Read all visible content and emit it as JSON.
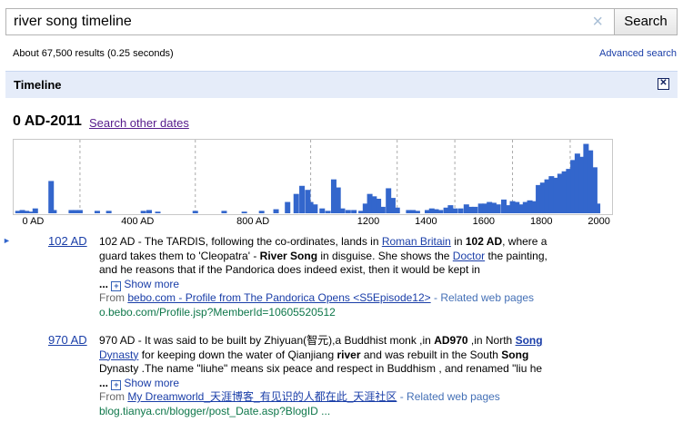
{
  "search": {
    "query": "river song timeline",
    "button": "Search"
  },
  "stats": {
    "text": "About 67,500 results (0.25 seconds)",
    "advanced": "Advanced search"
  },
  "timeline": {
    "title": "Timeline",
    "range": "0 AD-2011",
    "other_dates": "Search other dates"
  },
  "chart_data": {
    "type": "bar",
    "xlabel": "",
    "ylabel": "",
    "xlim": [
      -30,
      2020
    ],
    "tick_labels": [
      "0 AD",
      "400 AD",
      "800 AD",
      "1200",
      "1400",
      "1600",
      "1800",
      "2000"
    ],
    "tick_values": [
      0,
      400,
      800,
      1200,
      1400,
      1600,
      1800,
      2000
    ],
    "bars": [
      [
        -15,
        3
      ],
      [
        0,
        4
      ],
      [
        15,
        3
      ],
      [
        30,
        2
      ],
      [
        45,
        6
      ],
      [
        100,
        40
      ],
      [
        110,
        4
      ],
      [
        170,
        4
      ],
      [
        185,
        4
      ],
      [
        200,
        4
      ],
      [
        260,
        3
      ],
      [
        300,
        3
      ],
      [
        420,
        3
      ],
      [
        440,
        4
      ],
      [
        470,
        2
      ],
      [
        600,
        3
      ],
      [
        700,
        3
      ],
      [
        770,
        2
      ],
      [
        830,
        3
      ],
      [
        880,
        5
      ],
      [
        920,
        14
      ],
      [
        950,
        24
      ],
      [
        970,
        34
      ],
      [
        990,
        29
      ],
      [
        1000,
        14
      ],
      [
        1015,
        11
      ],
      [
        1040,
        6
      ],
      [
        1060,
        3
      ],
      [
        1080,
        42
      ],
      [
        1095,
        32
      ],
      [
        1110,
        6
      ],
      [
        1130,
        4
      ],
      [
        1150,
        4
      ],
      [
        1175,
        3
      ],
      [
        1190,
        12
      ],
      [
        1205,
        24
      ],
      [
        1220,
        21
      ],
      [
        1235,
        18
      ],
      [
        1250,
        8
      ],
      [
        1270,
        31
      ],
      [
        1285,
        19
      ],
      [
        1300,
        7
      ],
      [
        1340,
        4
      ],
      [
        1355,
        4
      ],
      [
        1370,
        3
      ],
      [
        1405,
        4
      ],
      [
        1420,
        6
      ],
      [
        1435,
        5
      ],
      [
        1450,
        4
      ],
      [
        1470,
        7
      ],
      [
        1485,
        10
      ],
      [
        1500,
        6
      ],
      [
        1520,
        6
      ],
      [
        1540,
        11
      ],
      [
        1555,
        8
      ],
      [
        1570,
        8
      ],
      [
        1590,
        12
      ],
      [
        1605,
        12
      ],
      [
        1620,
        14
      ],
      [
        1635,
        13
      ],
      [
        1650,
        11
      ],
      [
        1670,
        17
      ],
      [
        1685,
        10
      ],
      [
        1700,
        15
      ],
      [
        1715,
        14
      ],
      [
        1730,
        11
      ],
      [
        1745,
        14
      ],
      [
        1760,
        16
      ],
      [
        1775,
        15
      ],
      [
        1790,
        35
      ],
      [
        1805,
        38
      ],
      [
        1820,
        42
      ],
      [
        1835,
        46
      ],
      [
        1850,
        44
      ],
      [
        1865,
        49
      ],
      [
        1880,
        52
      ],
      [
        1895,
        55
      ],
      [
        1910,
        66
      ],
      [
        1925,
        74
      ],
      [
        1940,
        70
      ],
      [
        1955,
        86
      ],
      [
        1970,
        78
      ],
      [
        1985,
        57
      ],
      [
        1995,
        12
      ]
    ],
    "ylim": [
      0,
      90
    ],
    "grid": true
  },
  "results": [
    {
      "date": "102 AD",
      "line1_pre": "102 AD - The TARDIS, following the co-ordinates, lands in ",
      "line1_link": "Roman Britain",
      "line1_mid": " in ",
      "line1_bold": "102 AD",
      "line1_post": ", where a",
      "line2_pre": "guard takes them to 'Cleopatra' - ",
      "line2_bold": "River Song",
      "line2_mid": " in disguise. She shows the ",
      "line2_link": "Doctor",
      "line2_post": " the painting,",
      "line3": "and he reasons that if the Pandorica does indeed exist, then it would be kept in",
      "ellipsis": "...",
      "show_more": "Show more",
      "from": "From ",
      "source": "bebo.com - Profile from The Pandorica Opens <S5Episode12>",
      "related": " - Related web pages",
      "url": "o.bebo.com/Profile.jsp?MemberId=10605520512"
    },
    {
      "date": "970 AD",
      "line1_pre": "970 AD - It was said to be built by Zhiyuan(智元),a Buddhist monk ,in ",
      "line1_bold": "AD970",
      "line1_mid": " ,in North ",
      "line1_link": "Song",
      "line2_link": "Dynasty",
      "line2_pre": " for keeping down the water of Qianjiang ",
      "line2_bold": "river",
      "line2_mid": " and was rebuilt in the South ",
      "line2_bold2": "Song",
      "line3": "Dynasty .The name \"liuhe\" means six peace and respect in Buddhism , and renamed \"liu he",
      "ellipsis": "...",
      "show_more": "Show more",
      "from": "From ",
      "source": "My Dreamworld_天涯博客_有见识的人都在此_天涯社区",
      "related": " - Related web pages",
      "url": "blog.tianya.cn/blogger/post_Date.asp?BlogID ..."
    }
  ],
  "icons": {
    "clear": "×",
    "close": "✕",
    "plus": "+",
    "arrow": "►"
  },
  "colors": {
    "bar": "#3366cc",
    "link": "#1a3ea8",
    "visited": "#551a8b",
    "url": "#0e774a",
    "header_bg": "#e5ecf9"
  }
}
